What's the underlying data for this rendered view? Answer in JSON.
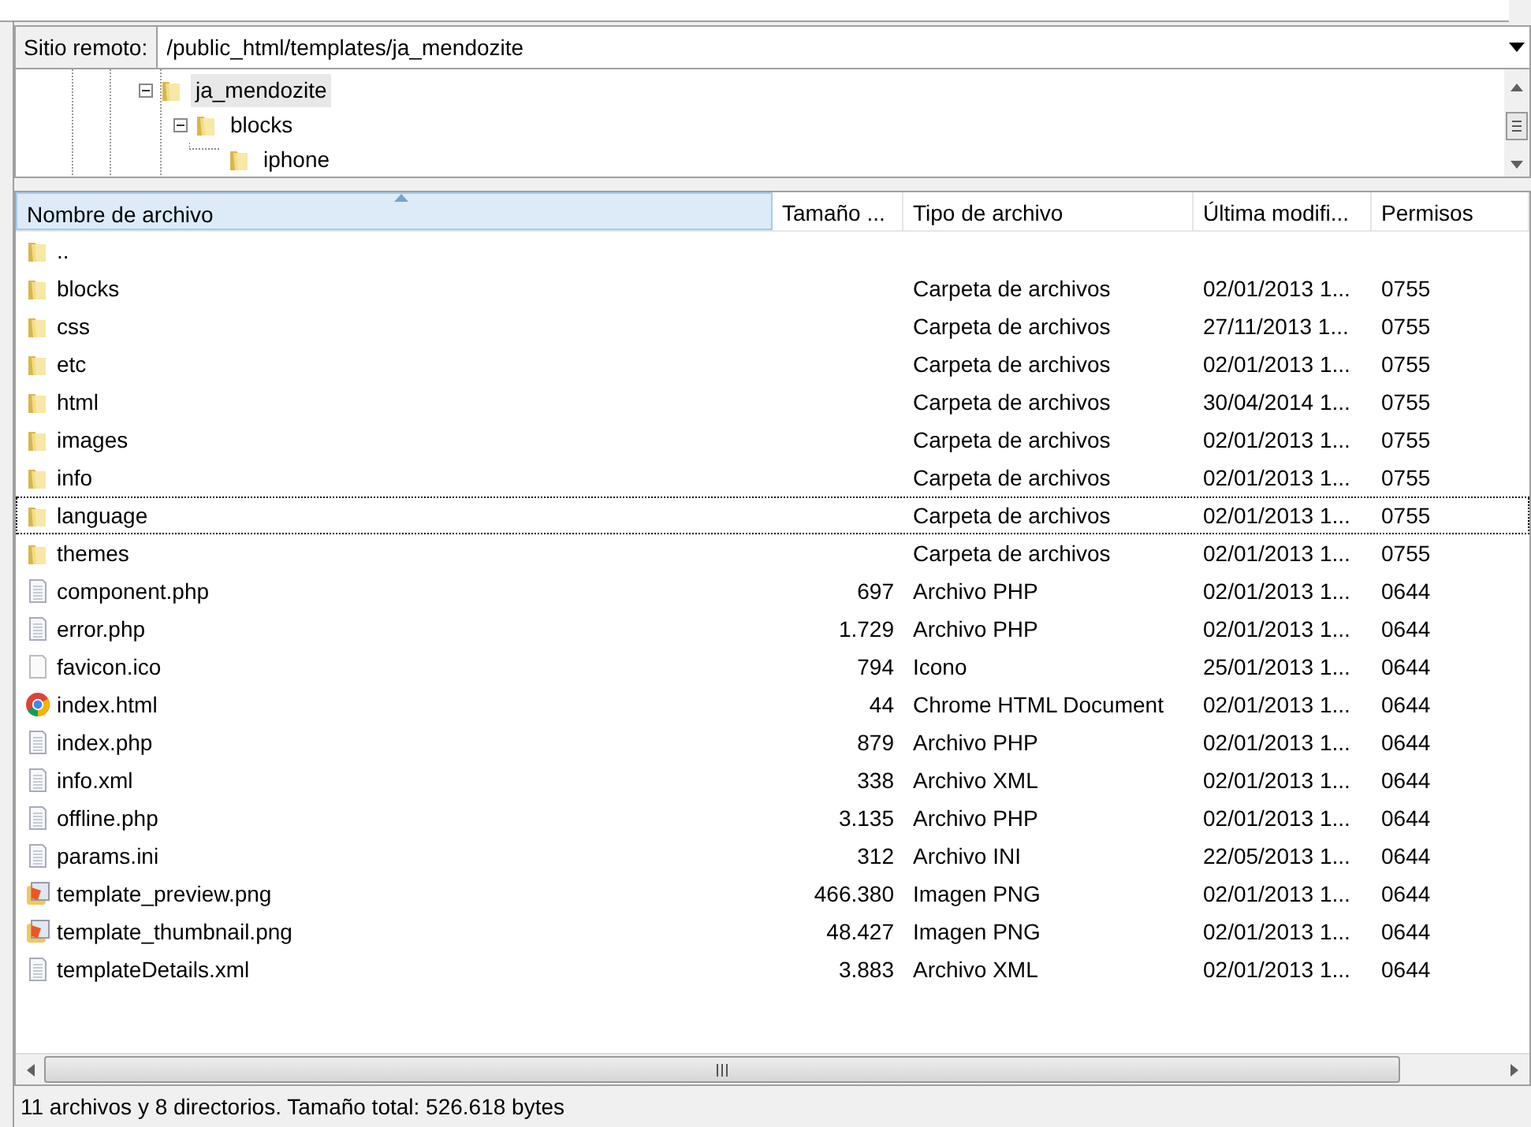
{
  "remote_site": {
    "label": "Sitio remoto:",
    "path": "/public_html/templates/ja_mendozite"
  },
  "tree": [
    {
      "label": "ja_mendozite",
      "selected": true,
      "expanded": true,
      "children": [
        {
          "label": "blocks",
          "selected": false,
          "expanded": true,
          "children": [
            {
              "label": "iphone",
              "selected": false
            }
          ]
        }
      ]
    }
  ],
  "file_list": {
    "columns": [
      {
        "label": "Nombre de archivo",
        "sorted": true
      },
      {
        "label": "Tamaño ...",
        "sorted": false
      },
      {
        "label": "Tipo de archivo",
        "sorted": false
      },
      {
        "label": "Última modifi...",
        "sorted": false
      },
      {
        "label": "Permisos",
        "sorted": false
      }
    ],
    "rows": [
      {
        "kind": "folder",
        "name": "..",
        "focused": false
      },
      {
        "kind": "folder",
        "name": "blocks",
        "type": "Carpeta de archivos",
        "modified": "02/01/2013 1...",
        "permissions": "0755",
        "focused": false
      },
      {
        "kind": "folder",
        "name": "css",
        "type": "Carpeta de archivos",
        "modified": "27/11/2013 1...",
        "permissions": "0755",
        "focused": false
      },
      {
        "kind": "folder",
        "name": "etc",
        "type": "Carpeta de archivos",
        "modified": "02/01/2013 1...",
        "permissions": "0755",
        "focused": false
      },
      {
        "kind": "folder",
        "name": "html",
        "type": "Carpeta de archivos",
        "modified": "30/04/2014 1...",
        "permissions": "0755",
        "focused": false
      },
      {
        "kind": "folder",
        "name": "images",
        "type": "Carpeta de archivos",
        "modified": "02/01/2013 1...",
        "permissions": "0755",
        "focused": false
      },
      {
        "kind": "folder",
        "name": "info",
        "type": "Carpeta de archivos",
        "modified": "02/01/2013 1...",
        "permissions": "0755",
        "focused": false
      },
      {
        "kind": "folder",
        "name": "language",
        "type": "Carpeta de archivos",
        "modified": "02/01/2013 1...",
        "permissions": "0755",
        "focused": true
      },
      {
        "kind": "folder",
        "name": "themes",
        "type": "Carpeta de archivos",
        "modified": "02/01/2013 1...",
        "permissions": "0755",
        "focused": false
      },
      {
        "kind": "text",
        "name": "component.php",
        "size": "697",
        "type": "Archivo PHP",
        "modified": "02/01/2013 1...",
        "permissions": "0644",
        "focused": false
      },
      {
        "kind": "text",
        "name": "error.php",
        "size": "1.729",
        "type": "Archivo PHP",
        "modified": "02/01/2013 1...",
        "permissions": "0644",
        "focused": false
      },
      {
        "kind": "blank",
        "name": "favicon.ico",
        "size": "794",
        "type": "Icono",
        "modified": "25/01/2013 1...",
        "permissions": "0644",
        "focused": false
      },
      {
        "kind": "browser",
        "name": "index.html",
        "size": "44",
        "type": "Chrome HTML Document",
        "modified": "02/01/2013 1...",
        "permissions": "0644",
        "focused": false
      },
      {
        "kind": "text",
        "name": "index.php",
        "size": "879",
        "type": "Archivo PHP",
        "modified": "02/01/2013 1...",
        "permissions": "0644",
        "focused": false
      },
      {
        "kind": "text",
        "name": "info.xml",
        "size": "338",
        "type": "Archivo XML",
        "modified": "02/01/2013 1...",
        "permissions": "0644",
        "focused": false
      },
      {
        "kind": "text",
        "name": "offline.php",
        "size": "3.135",
        "type": "Archivo PHP",
        "modified": "02/01/2013 1...",
        "permissions": "0644",
        "focused": false
      },
      {
        "kind": "text",
        "name": "params.ini",
        "size": "312",
        "type": "Archivo INI",
        "modified": "22/05/2013 1...",
        "permissions": "0644",
        "focused": false
      },
      {
        "kind": "image",
        "name": "template_preview.png",
        "size": "466.380",
        "type": "Imagen PNG",
        "modified": "02/01/2013 1...",
        "permissions": "0644",
        "focused": false
      },
      {
        "kind": "image",
        "name": "template_thumbnail.png",
        "size": "48.427",
        "type": "Imagen PNG",
        "modified": "02/01/2013 1...",
        "permissions": "0644",
        "focused": false
      },
      {
        "kind": "text",
        "name": "templateDetails.xml",
        "size": "3.883",
        "type": "Archivo XML",
        "modified": "02/01/2013 1...",
        "permissions": "0644",
        "focused": false
      }
    ]
  },
  "status_bar": "11 archivos y 8 directorios. Tamaño total: 526.618 bytes"
}
